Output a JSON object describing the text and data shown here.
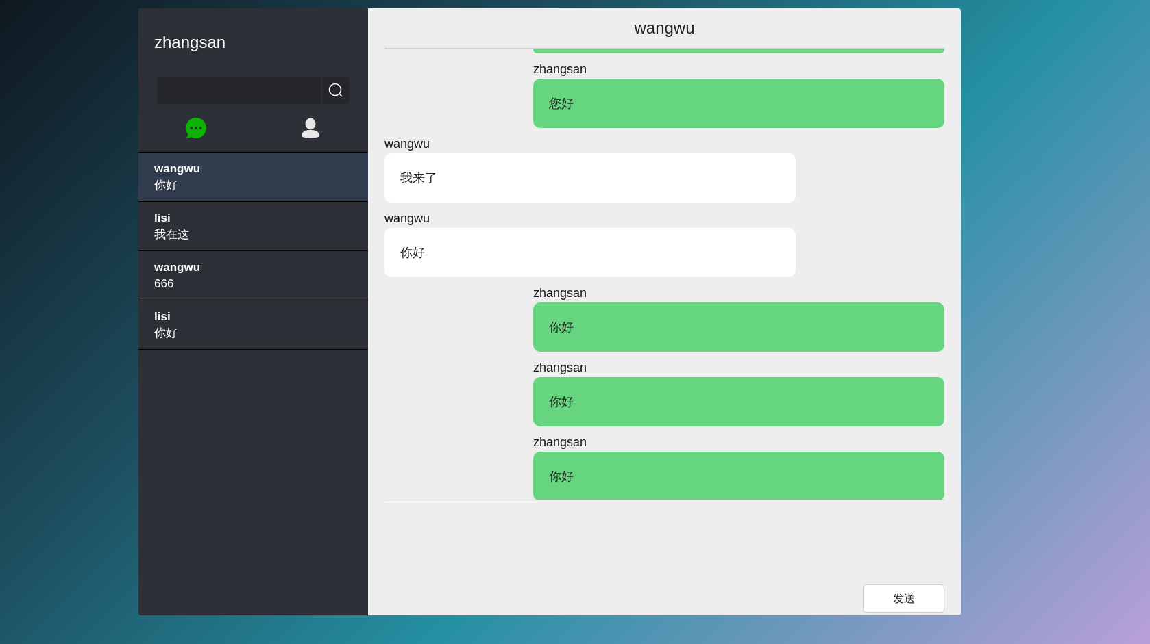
{
  "user": {
    "name": "zhangsan"
  },
  "nav_tabs": [
    {
      "kind": "chats",
      "selected": true
    },
    {
      "kind": "contacts",
      "selected": false
    }
  ],
  "conversations": [
    {
      "name": "wangwu",
      "last_message": "你好",
      "selected": true
    },
    {
      "name": "lisi",
      "last_message": "我在这",
      "selected": false
    },
    {
      "name": "wangwu",
      "last_message": "666",
      "selected": false
    },
    {
      "name": "lisi",
      "last_message": "你好",
      "selected": false
    }
  ],
  "chat": {
    "title": "wangwu",
    "messages": [
      {
        "mine": true,
        "cut_off": true
      },
      {
        "sender": "zhangsan",
        "text": "您好",
        "mine": true
      },
      {
        "sender": "wangwu",
        "text": "我来了",
        "mine": false
      },
      {
        "sender": "wangwu",
        "text": "你好",
        "mine": false
      },
      {
        "sender": "zhangsan",
        "text": "你好",
        "mine": true
      },
      {
        "sender": "zhangsan",
        "text": "你好",
        "mine": true
      },
      {
        "sender": "zhangsan",
        "text": "你好",
        "mine": true
      }
    ],
    "send_button": "发送"
  }
}
